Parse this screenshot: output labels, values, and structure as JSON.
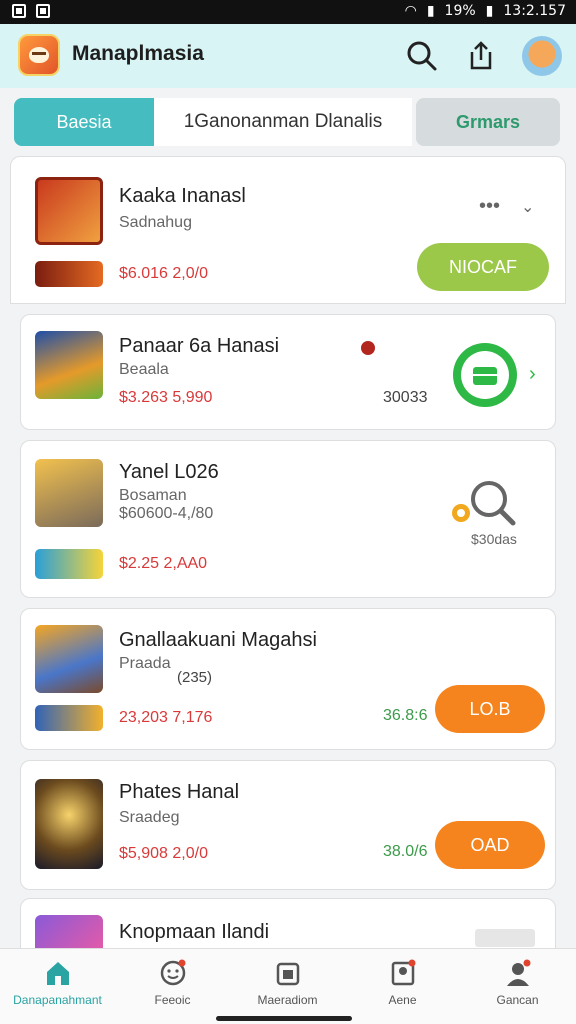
{
  "status_bar": {
    "battery": "19%",
    "time": "13:2.157"
  },
  "app": {
    "title": "Manaplmasia"
  },
  "header_icons": [
    "search-icon",
    "share-icon",
    "avatar"
  ],
  "tabs": [
    {
      "label": "Baesia",
      "active": true
    },
    {
      "label": "1Ganonanman Dlanalis",
      "active": false
    },
    {
      "label": "Grmars",
      "active": false
    }
  ],
  "cards": [
    {
      "title": "Kaaka Inanasl",
      "subtitle": "Sadnahug",
      "price": "$6.016 2,0/0",
      "action": "NIOCAF"
    },
    {
      "title": "Panaar 6a Hanasi",
      "subtitle": "Beaala",
      "price": "$3.263 5,990",
      "aux": "30033"
    },
    {
      "title": "Yanel L026",
      "subtitle": "Bosaman",
      "meta": "$60600-4,/80",
      "price": "$2.25  2,AA0",
      "aux": "$30das"
    },
    {
      "title": "Gnallaakuani Magahsi",
      "subtitle": "Praada",
      "meta": "(235)",
      "price": "23,203 7,176",
      "green": "36.8:6",
      "action": "LO.B"
    },
    {
      "title": "Phates Hanal",
      "subtitle": "Sraadeg",
      "price": "$5,908 2,0/0",
      "green": "38.0/6",
      "action": "OAD"
    },
    {
      "title": "Knopmaan Ilandi"
    }
  ],
  "nav": [
    {
      "label": "Danapanahmant",
      "icon": "home-icon",
      "active": true
    },
    {
      "label": "Feeoic",
      "icon": "smile-icon",
      "active": false
    },
    {
      "label": "Maeradiom",
      "icon": "calendar-icon",
      "active": false
    },
    {
      "label": "Aene",
      "icon": "map-icon",
      "active": false
    },
    {
      "label": "Gancan",
      "icon": "profile-icon",
      "active": false
    }
  ],
  "colors": {
    "accent": "#45bcbf",
    "action_green": "#9cc84a",
    "action_orange": "#f5841e",
    "price_red": "#d83a3a"
  }
}
